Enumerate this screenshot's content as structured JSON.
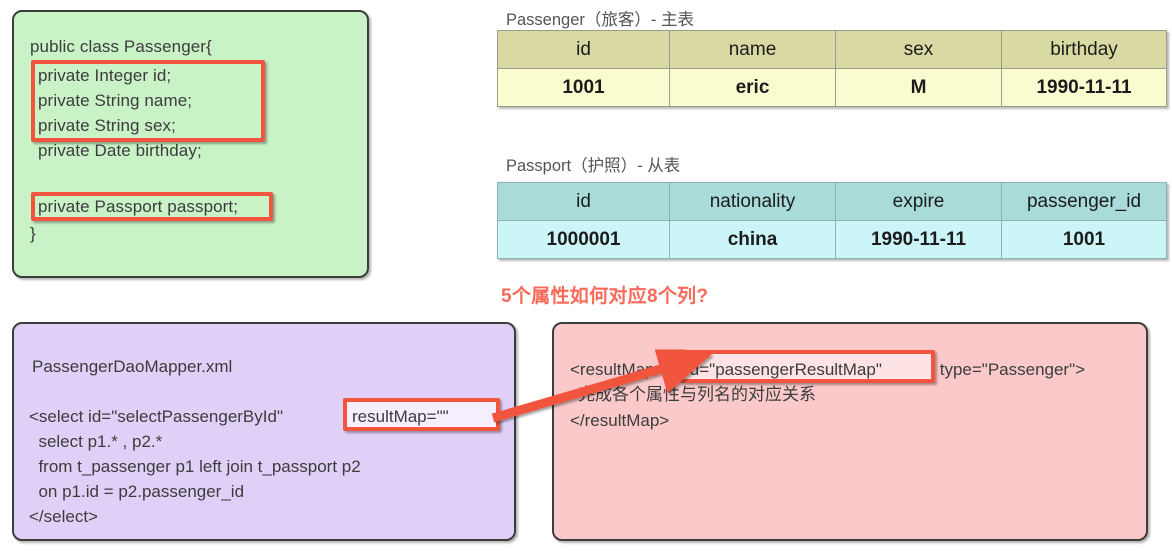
{
  "class_panel": {
    "header": "public class Passenger{",
    "fields": [
      "private Integer id;",
      "private String name;",
      "private String sex;",
      "private Date birthday;"
    ],
    "relation_field": "private Passport passport;",
    "footer": "}",
    "bg_color": "#c9f2c7"
  },
  "passenger_table": {
    "title": "Passenger（旅客）- 主表",
    "columns": [
      "id",
      "name",
      "sex",
      "birthday"
    ],
    "rows": [
      [
        "1001",
        "eric",
        "M",
        "1990-11-11"
      ]
    ],
    "header_color": "#d9d9a3",
    "cell_color": "#fbfbd0"
  },
  "passport_table": {
    "title": "Passport（护照）- 从表",
    "columns": [
      "id",
      "nationality",
      "expire",
      "passenger_id"
    ],
    "rows": [
      [
        "1000001",
        "china",
        "1990-11-11",
        "1001"
      ]
    ],
    "header_color": "#a9dcd8",
    "cell_color": "#ccf5f7"
  },
  "question_caption": {
    "text": "5个属性如何对应8个列?",
    "color": "#f96a5a"
  },
  "mapper_panel": {
    "filename": "PassengerDaoMapper.xml",
    "select_open_prefix": "<select id=\"selectPassengerById\" ",
    "highlight": "resultMap=\"\"",
    "sql_lines": [
      "  select p1.* , p2.*",
      "  from t_passenger p1 left join t_passport p2",
      "  on p1.id = p2.passenger_id"
    ],
    "select_close": "</select>",
    "bg_color": "#e0d0f7"
  },
  "resultmap_panel": {
    "tag_open_prefix": "<resultMap ",
    "highlight": "id=\"passengerResultMap\"",
    "tag_open_suffix": " type=\"Passenger\">",
    "description": "完成各个属性与列名的对应关系",
    "tag_close": "</resultMap>",
    "bg_color": "#fbc9c9"
  },
  "arrows": {
    "color": "#f2543d",
    "labels": [
      "fields-to-passenger-table",
      "passport-field-to-passport-table",
      "resultmap-link"
    ]
  }
}
